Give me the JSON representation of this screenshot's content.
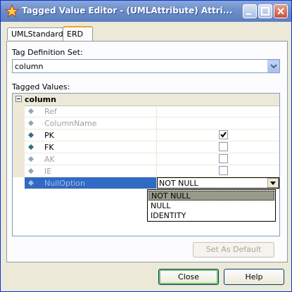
{
  "window": {
    "title": "Tagged Value Editor - (UMLAttribute) Attri..."
  },
  "tabs": [
    {
      "label": "UMLStandard",
      "active": false
    },
    {
      "label": "ERD",
      "active": true
    }
  ],
  "tag_definition": {
    "label": "Tag Definition Set:",
    "value": "column"
  },
  "tagged_values": {
    "label": "Tagged Values:",
    "group": "column",
    "rows": [
      {
        "name": "Ref",
        "enabled": false,
        "type": "text",
        "value": ""
      },
      {
        "name": "ColumnName",
        "enabled": false,
        "type": "text",
        "value": ""
      },
      {
        "name": "PK",
        "enabled": true,
        "type": "checkbox",
        "checked": true
      },
      {
        "name": "FK",
        "enabled": true,
        "type": "checkbox",
        "checked": false
      },
      {
        "name": "AK",
        "enabled": false,
        "type": "checkbox",
        "checked": false
      },
      {
        "name": "IE",
        "enabled": false,
        "type": "checkbox",
        "checked": false
      },
      {
        "name": "NullOption",
        "enabled": true,
        "type": "dropdown",
        "value": "NOT NULL",
        "selected": true
      }
    ],
    "dropdown_options": [
      "NOT NULL",
      "NULL",
      "IDENTITY"
    ],
    "dropdown_selected": "NOT NULL"
  },
  "buttons": {
    "set_default": "Set As Default",
    "close": "Close",
    "help": "Help"
  },
  "colors": {
    "titlebar": "#6d8fc9",
    "selection": "#316ac5",
    "diamond": "#2e6f7a"
  }
}
